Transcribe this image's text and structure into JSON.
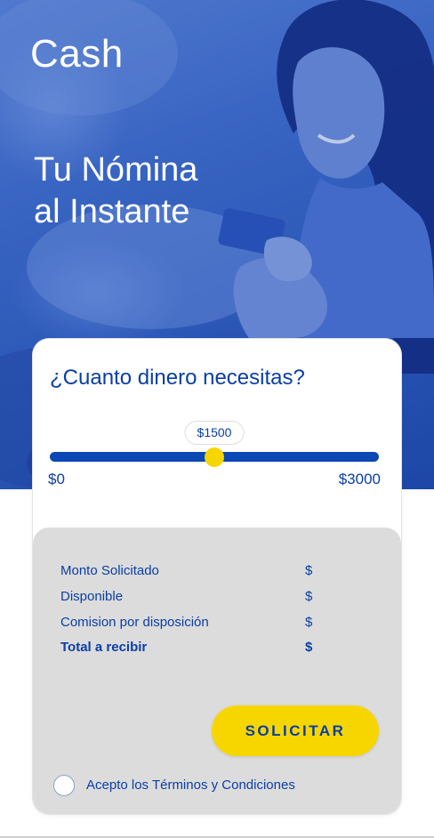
{
  "app": {
    "logo": "Cash"
  },
  "hero": {
    "headline_line1": "Tu Nómina",
    "headline_line2": "al Instante"
  },
  "card": {
    "question": "¿Cuanto dinero necesitas?",
    "slider": {
      "min_label": "$0",
      "max_label": "$3000",
      "value_label": "$1500",
      "value": 1500,
      "min": 0,
      "max": 3000
    },
    "summary": {
      "rows": [
        {
          "label": "Monto Solicitado",
          "value": "$"
        },
        {
          "label": "Disponible",
          "value": "$"
        },
        {
          "label": "Comision por disposición",
          "value": "$"
        },
        {
          "label": "Total a recibir",
          "value": "$"
        }
      ]
    },
    "submit_label": "SOLICITAR",
    "terms_label": "Acepto los Términos y Condiciones"
  },
  "colors": {
    "brand_blue": "#0a3ea6",
    "slider_blue": "#0b47b5",
    "accent_yellow": "#f7d600",
    "summary_bg": "#dcdcdc"
  }
}
